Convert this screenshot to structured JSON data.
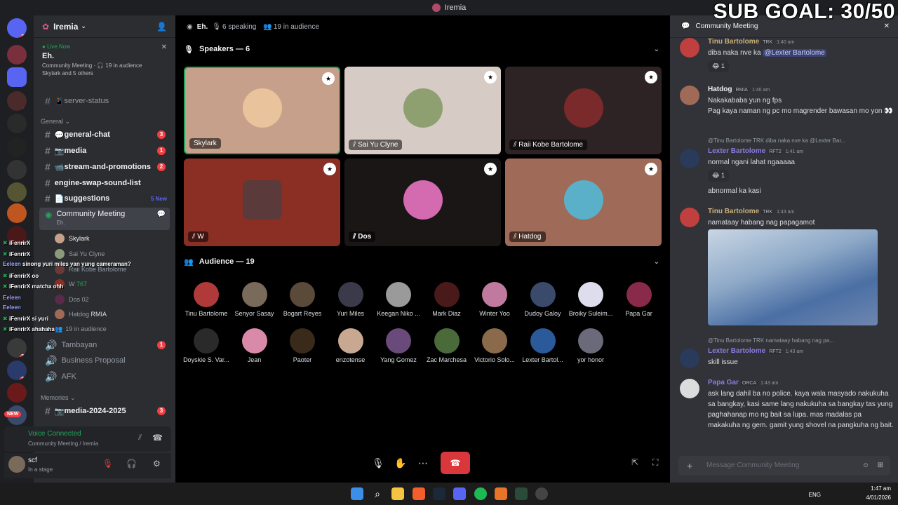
{
  "window": {
    "title": "Iremia"
  },
  "overlay": {
    "sub_goal": "SUB GOAL: 30/50",
    "chat": [
      {
        "name": "iFenrirX",
        "text": ""
      },
      {
        "name": "iFenrirX",
        "text": ""
      },
      {
        "name": "Eeleen",
        "text": "sinong yuri miles yan yung cameraman?"
      },
      {
        "name": "iFenrirX",
        "text": "oo"
      },
      {
        "name": "iFenrirX",
        "text": "matcha ohh"
      },
      {
        "name": "Eeleen",
        "text": ""
      },
      {
        "name": "Eeleen",
        "text": ""
      },
      {
        "name": "iFenrirX",
        "text": "si yuri"
      },
      {
        "name": "iFenrirX",
        "text": "ahahaha"
      }
    ]
  },
  "server": {
    "name": "Iremia",
    "live": {
      "label": "Live Now",
      "stage": "Eh.",
      "sub": "Community Meeting · 🎧 19 in audience",
      "members": "Skylark and 5 others"
    },
    "channels": [
      {
        "name": "server-status",
        "prefix": "#",
        "icon": "📱",
        "count": ""
      },
      {
        "category": "General"
      },
      {
        "name": "general-chat",
        "prefix": "#",
        "icon": "💬",
        "count": "3"
      },
      {
        "name": "media",
        "prefix": "#",
        "icon": "📷",
        "count": "1"
      },
      {
        "name": "stream-and-promotions",
        "prefix": "#",
        "icon": "📹",
        "count": "2"
      },
      {
        "name": "engine-swap-sound-list",
        "prefix": "#",
        "icon": "",
        "count": ""
      },
      {
        "name": "suggestions",
        "prefix": "#",
        "icon": "📄",
        "count": "5 New"
      },
      {
        "name": "Community Meeting",
        "prefix": "📢",
        "sub": "Eh.",
        "active": true
      }
    ],
    "voice_members": [
      "Skylark",
      "Sai Yu Clyne",
      "Raii Kobe Bartolome",
      "W",
      "Dos",
      "Hatdog"
    ],
    "voice_extras": {
      "w_badge": "767",
      "dos_badge": "02",
      "hatdog_badge": "RMIA",
      "audience": "19 in audience"
    },
    "channels2": [
      {
        "name": "Tambayan",
        "count": "1"
      },
      {
        "name": "Business Proposal",
        "count": ""
      },
      {
        "name": "AFK",
        "count": ""
      },
      {
        "category": "Memories"
      },
      {
        "name": "media-2024-2025",
        "count": "3",
        "prefix": "#",
        "icon": "📷"
      }
    ],
    "voice_panel": {
      "title": "Voice Connected",
      "sub": "Community Meeting / Iremia"
    },
    "user": {
      "name": "scf",
      "status": "In a stage"
    }
  },
  "stage": {
    "title": "Eh.",
    "speaking": "6 speaking",
    "audience_count": "19 in audience",
    "speakers_label": "Speakers — 6",
    "audience_label": "Audience — 19",
    "speakers": [
      {
        "name": "Skylark",
        "bg": "#c7a08c"
      },
      {
        "name": "Sai Yu Clyne",
        "bg": "#d7cbc5"
      },
      {
        "name": "Raii Kobe Bartolome",
        "bg": "#2d2325"
      },
      {
        "name": "W",
        "bg": "#8b2f24"
      },
      {
        "name": "Dos",
        "bg": "#1a1616"
      },
      {
        "name": "Hatdog",
        "bg": "#a06a58"
      }
    ],
    "audience": [
      "Tinu Bartolome",
      "Senyor Sasay",
      "Bogart Reyes",
      "Yuri Miles",
      "Keegan Niko ...",
      "Mark Diaz",
      "Winter Yoo",
      "Dudoy Galoy",
      "Broiky Suleim...",
      "Papa Gar",
      "Doyskie S. Var...",
      "Jean",
      "Paoter",
      "enzotense",
      "Yang Gomez",
      "Zac Marchesa",
      "Victorio Solo...",
      "Lexter Bartol...",
      "yor honor"
    ]
  },
  "chat": {
    "title": "Community Meeting",
    "input_placeholder": "Message Community Meeting",
    "messages": [
      {
        "author": "Tinu Bartolome",
        "tag": "TRK",
        "time": "1:40 am",
        "text": "diba naka nve ka",
        "mention": "@Lexter Bartolome",
        "react": "😂 1"
      },
      {
        "author": "Hatdog",
        "tag": "RMIA",
        "time": "1:40 am",
        "lines": [
          "Nakakababa yun ng fps",
          "Pag kaya naman ng pc mo magrender bawasan mo yon 👀"
        ]
      },
      {
        "reply": "@Tinu Bartolome TRK diba naka nve ka @Lexter Bar...",
        "author": "Lexter Bartolome",
        "tag": "RFT2",
        "time": "1:41 am",
        "lines": [
          "normal ngani lahat ngaaaaa"
        ],
        "react": "😂 1",
        "extra": "abnormal ka kasi"
      },
      {
        "author": "Tinu Bartolome",
        "tag": "TRK",
        "time": "1:43 am",
        "text": "namataay habang nag papagamot"
      },
      {
        "reply": "@Tinu Bartolome TRK namataay habang nag pa...",
        "author": "Lexter Bartolome",
        "tag": "RFT2",
        "time": "1:43 am",
        "text": "skill issue"
      },
      {
        "author": "Papa Gar",
        "tag": "ORCA",
        "time": "1:43 am",
        "text": "ask lang dahil ba no police. kaya wala masyado nakukuha sa bangkay, kasi same lang nakukuha sa bangkay tas yung paghahanap mo ng bait sa lupa. mas madalas pa makakuha ng gem. gamit yung shovel na pangkuha ng bait."
      }
    ]
  },
  "taskbar": {
    "lang": "ENG",
    "time": "1:47 am",
    "date": "4/01/2026"
  }
}
